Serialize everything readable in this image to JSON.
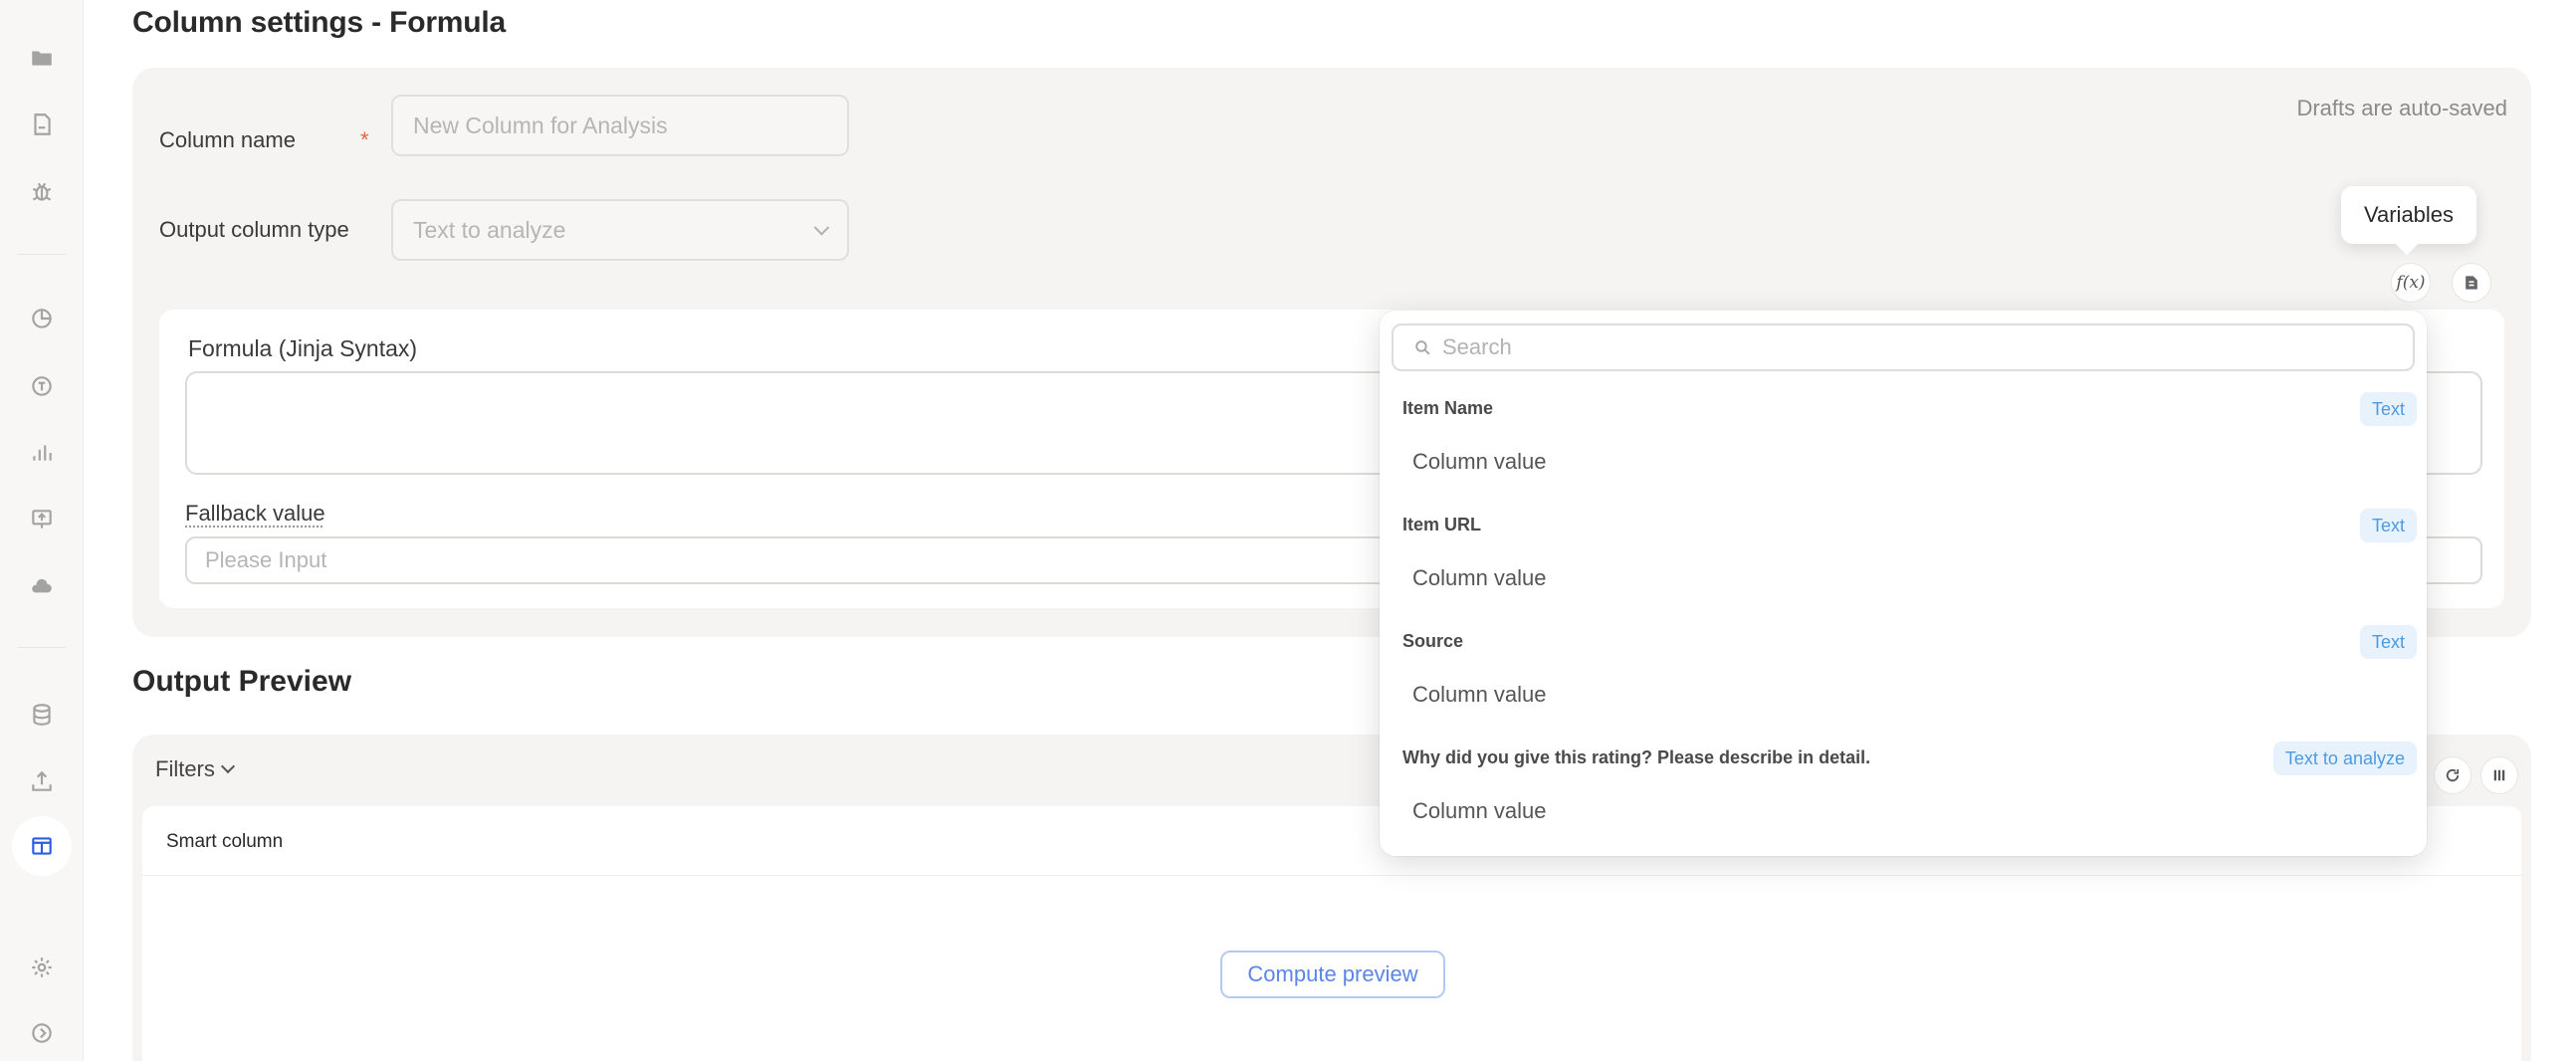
{
  "page": {
    "title": "Column settings - Formula",
    "autosave_note": "Drafts are auto-saved"
  },
  "form": {
    "column_name_label": "Column name",
    "required_mark": "*",
    "column_name_placeholder": "New Column for Analysis",
    "output_type_label": "Output column type",
    "output_type_value": "Text to analyze",
    "formula_label": "Formula (Jinja Syntax)",
    "fallback_label": "Fallback value",
    "fallback_placeholder": "Please Input"
  },
  "toolbar": {
    "tooltip": "Variables",
    "fx_label": "f(x)"
  },
  "variables": {
    "search_placeholder": "Search",
    "items": [
      {
        "name": "Item Name",
        "type": "Text",
        "value": "Column value"
      },
      {
        "name": "Item URL",
        "type": "Text",
        "value": "Column value"
      },
      {
        "name": "Source",
        "type": "Text",
        "value": "Column value"
      },
      {
        "name": "Why did you give this rating? Please describe in detail.",
        "type": "Text to analyze",
        "value": "Column value"
      }
    ]
  },
  "preview": {
    "title": "Output Preview",
    "filters_label": "Filters",
    "column_header": "Smart column",
    "compute_button": "Compute preview"
  },
  "sidebar": {
    "icons": [
      "folder-icon",
      "document-icon",
      "bug-icon",
      "chart-pie-icon",
      "tag-icon",
      "bar-chart-icon",
      "presentation-icon",
      "cloud-icon",
      "database-icon",
      "upload-icon",
      "table-icon",
      "settings-icon",
      "expand-icon"
    ],
    "active": "table-icon"
  }
}
